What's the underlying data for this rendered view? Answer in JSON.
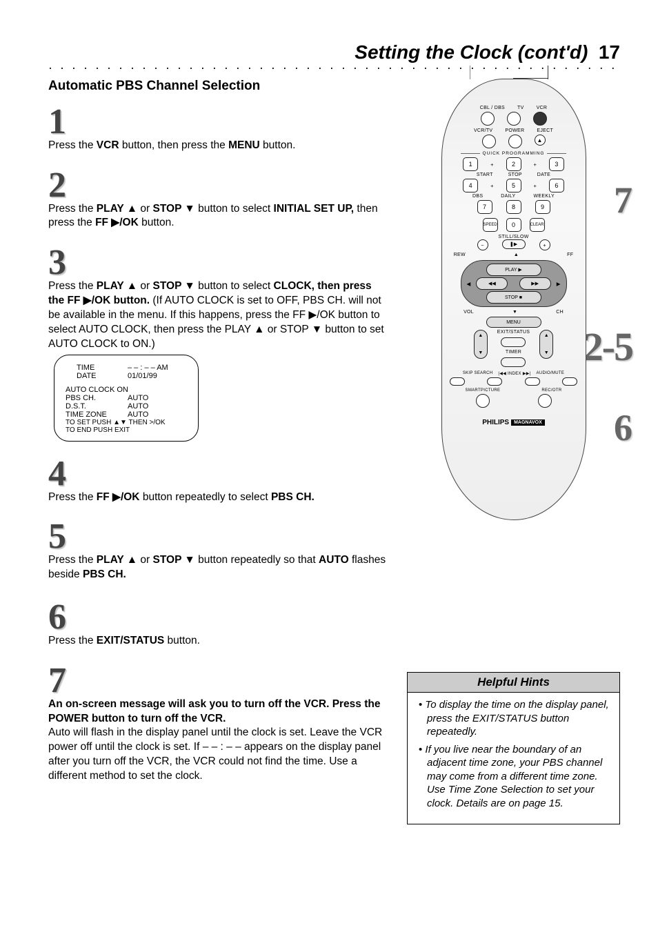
{
  "header": {
    "title": "Setting the Clock (cont'd)",
    "page": "17"
  },
  "subhead": "Automatic PBS Channel Selection",
  "steps": {
    "s1": {
      "num": "1",
      "html": "Press the <b>VCR</b> button, then press the <b>MENU</b> button."
    },
    "s2": {
      "num": "2",
      "html": "Press the <b>PLAY ▲</b> or <b>STOP ▼</b> button to select <b>INITIAL SET UP,</b> then press the <b>FF ▶/OK</b> button."
    },
    "s3": {
      "num": "3",
      "html": "Press the <b>PLAY ▲</b> or <b>STOP ▼</b> button to select <b>CLOCK, then press the FF ▶/OK button.</b> (If AUTO CLOCK is set to OFF, PBS CH. will not be available in the menu. If this happens, press the FF ▶/OK button to select AUTO CLOCK, then press the PLAY ▲ or STOP ▼ button to set AUTO CLOCK to ON.)"
    },
    "s4": {
      "num": "4",
      "html": "Press the <b>FF ▶/OK</b> button repeatedly to select <b>PBS CH.</b>"
    },
    "s5": {
      "num": "5",
      "html": "Press the <b>PLAY ▲</b> or <b>STOP ▼</b> button repeatedly so that <b>AUTO</b> flashes beside <b>PBS CH.</b>"
    },
    "s6": {
      "num": "6",
      "html": "Press the <b>EXIT/STATUS</b> button."
    },
    "s7": {
      "num": "7",
      "bold": "An on-screen message will ask you to turn off the VCR. Press the POWER button to turn off the VCR.",
      "rest": "Auto will flash in the display panel until the clock is set. Leave the VCR power off until the clock is set. If – – : – – appears on the display panel after you turn off the VCR, the VCR could not find the time. Use a different method to set the clock."
    }
  },
  "screen": {
    "time_label": "TIME",
    "time_val": "– – : – – AM",
    "date_label": "DATE",
    "date_val": "01/01/99",
    "autoclock": "AUTO CLOCK ON",
    "pbs_label": "PBS CH.",
    "pbs_val": "AUTO",
    "dst_label": "D.S.T.",
    "dst_val": "AUTO",
    "tz_label": "TIME ZONE",
    "tz_val": "AUTO",
    "line1": "TO SET PUSH ▲▼ THEN >/OK",
    "line2": "TO END PUSH EXIT"
  },
  "callouts": {
    "c7": "7",
    "c25": "2-5",
    "c6": "6"
  },
  "remote": {
    "row1": [
      "CBL / DBS",
      "TV",
      "VCR"
    ],
    "row2": [
      "VCR/TV",
      "POWER",
      "EJECT"
    ],
    "qp": "QUICK PROGRAMMING",
    "nums": [
      "1",
      "2",
      "3",
      "4",
      "5",
      "6",
      "7",
      "8",
      "9"
    ],
    "numrow2": [
      "START",
      "STOP",
      "DATE"
    ],
    "numrow3": [
      "DBS",
      "DAILY",
      "WEEKLY"
    ],
    "bottom": [
      "SPEED",
      "0",
      "CLEAR"
    ],
    "stillslow": "STILL/SLOW",
    "rew": "REW",
    "ff": "FF",
    "play": "PLAY ▶",
    "stop": "STOP ■",
    "menu": "MENU",
    "vol": "VOL",
    "ch": "CH",
    "exit": "EXIT/STATUS",
    "timer": "TIMER",
    "skiprow": [
      "SKIP SEARCH",
      "|◀◀ INDEX ▶▶|",
      "AUDIO/MUTE"
    ],
    "sp": "SMARTPICTURE",
    "otr": "REC/OTR",
    "brand": "PHILIPS",
    "brand2": "MAGNAVOX"
  },
  "hints": {
    "title": "Helpful Hints",
    "items": [
      "To display the time on the display panel, press the EXIT/STATUS button repeatedly.",
      "If you live near the boundary of an adjacent time zone, your PBS channel may come from a different time zone. Use Time Zone Selection to set your clock. Details are on page 15."
    ]
  }
}
